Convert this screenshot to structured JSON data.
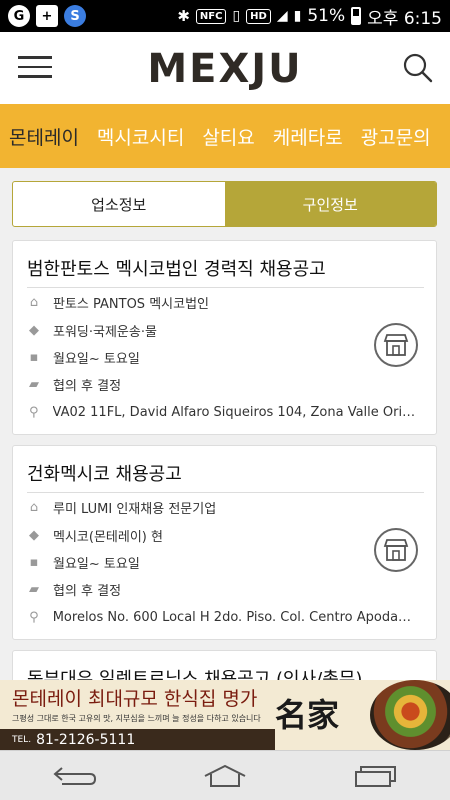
{
  "status_bar": {
    "battery": "51%",
    "time": "오후 6:15",
    "nfc": "NFC",
    "hd": "HD"
  },
  "header": {
    "logo": "MEXJU"
  },
  "categories": [
    {
      "label": "몬테레이"
    },
    {
      "label": "멕시코시티"
    },
    {
      "label": "살티요"
    },
    {
      "label": "케레타로"
    },
    {
      "label": "광고문의"
    }
  ],
  "tabs": {
    "business": "업소정보",
    "jobs": "구인정보"
  },
  "listings": [
    {
      "title": "범한판토스 멕시코법인 경력직 채용공고",
      "company": "판토스 PANTOS 멕시코법인",
      "category": "포워딩·국제운송·물",
      "schedule": "월요일~ 토요일",
      "salary": "협의 후 결정",
      "address": "VA02 11FL, David Alfaro Siqueiros 104, Zona Valle Orien..."
    },
    {
      "title": "건화멕시코 채용공고",
      "company": "루미 LUMI 인재채용 전문기업",
      "category": "멕시코(몬테레이) 현",
      "schedule": "월요일~ 토요일",
      "salary": "협의 후 결정",
      "address": "Morelos No. 600 Local H 2do. Piso. Col. Centro Apodaca..."
    },
    {
      "title": "동부대우 일렉트로닉스 채용공고 (인사/총무)"
    }
  ],
  "ad": {
    "headline": "몬테레이 최대규모 한식집 명가",
    "subline": "그평성 그대로 한국 고유의 맛, 지부심을 느끼며 늘 정성을 다하고 있습니다",
    "tel_label": "TEL.",
    "tel": "81-2126-5111",
    "brand": "名家"
  },
  "colors": {
    "accent": "#f2b431",
    "tab_active": "#b5a639"
  }
}
